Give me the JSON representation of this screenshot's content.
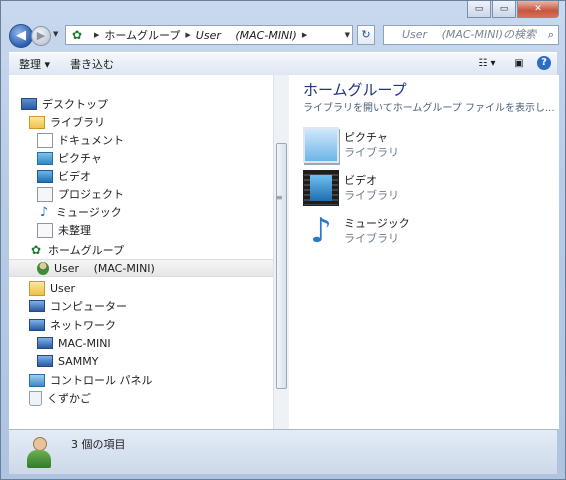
{
  "window": {
    "caption_minimize": "▭",
    "caption_maximize": "▭",
    "caption_close": "✕"
  },
  "nav": {
    "back_glyph": "◀",
    "forward_glyph": "▶",
    "history_glyph": "▼",
    "address_crumbs": [
      "ホームグループ",
      "User　 (MAC-MINI)"
    ],
    "address_sep": "▶",
    "address_dropdown": "▼",
    "refresh_glyph": "↻",
    "search_placeholder": "User　 (MAC-MINI)の検索",
    "search_glyph": "⌕"
  },
  "toolbar": {
    "organize_label": "整理 ▾",
    "burn_label": "書き込む",
    "view_glyph": "☷ ▾",
    "preview_glyph": "▣",
    "help_label": "?"
  },
  "tree": [
    {
      "label": "デスクトップ",
      "icon": "desktop-icon",
      "indent": 0
    },
    {
      "label": "ライブラリ",
      "icon": "library-icon",
      "indent": 1
    },
    {
      "label": "ドキュメント",
      "icon": "documents-icon",
      "indent": 2
    },
    {
      "label": "ピクチャ",
      "icon": "pictures-icon",
      "indent": 2
    },
    {
      "label": "ビデオ",
      "icon": "videos-icon",
      "indent": 2
    },
    {
      "label": "プロジェクト",
      "icon": "projects-icon",
      "indent": 2
    },
    {
      "label": "ミュージック",
      "icon": "music-icon",
      "indent": 2
    },
    {
      "label": "未整理",
      "icon": "unsorted-icon",
      "indent": 2
    },
    {
      "label": "ホームグループ",
      "icon": "homegroup-icon",
      "indent": 1
    },
    {
      "label": "User　 (MAC-MINI)",
      "icon": "user-icon",
      "indent": 2,
      "selected": true
    },
    {
      "label": "User",
      "icon": "user-folder-icon",
      "indent": 1
    },
    {
      "label": "コンピューター",
      "icon": "computer-icon",
      "indent": 1
    },
    {
      "label": "ネットワーク",
      "icon": "network-icon",
      "indent": 1
    },
    {
      "label": "MAC-MINI",
      "icon": "network-pc-icon",
      "indent": 2
    },
    {
      "label": "SAMMY",
      "icon": "network-pc-icon",
      "indent": 2
    },
    {
      "label": "コントロール パネル",
      "icon": "control-panel-icon",
      "indent": 1
    },
    {
      "label": "くずかご",
      "icon": "recycle-bin-icon",
      "indent": 1
    }
  ],
  "scroll": {
    "grip_glyph": "≡"
  },
  "content": {
    "title": "ホームグループ",
    "description": "ライブラリを開いてホームグループ ファイルを表示し...",
    "items": [
      {
        "name": "ピクチャ",
        "sub": "ライブラリ",
        "icon": "pictures-library-icon"
      },
      {
        "name": "ビデオ",
        "sub": "ライブラリ",
        "icon": "videos-library-icon"
      },
      {
        "name": "ミュージック",
        "sub": "ライブラリ",
        "icon": "music-library-icon"
      }
    ]
  },
  "status": {
    "text": "3 個の項目"
  }
}
